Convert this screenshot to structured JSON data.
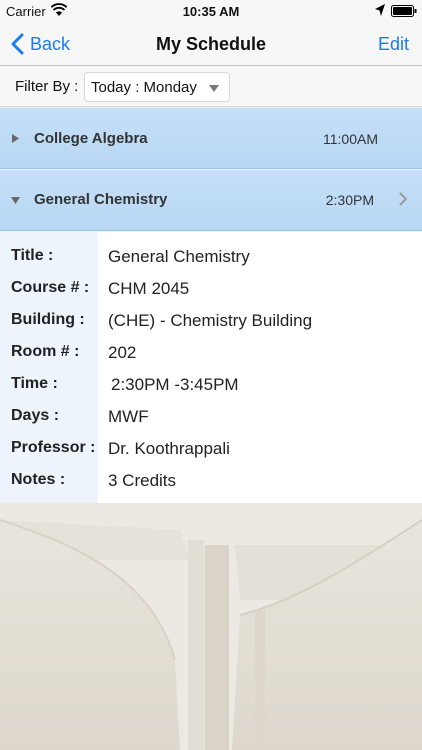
{
  "status_bar": {
    "carrier": "Carrier",
    "time": "10:35 AM",
    "icons": [
      "wifi-icon",
      "location-arrow-icon",
      "battery-icon"
    ]
  },
  "nav": {
    "back_label": "Back",
    "title": "My Schedule",
    "edit_label": "Edit",
    "accent_color": "#1a7cf5"
  },
  "filter": {
    "label": "Filter By :",
    "selected": "Today : Monday"
  },
  "courses": [
    {
      "name": "College Algebra",
      "time": "11:00AM",
      "expanded": false
    },
    {
      "name": "General Chemistry",
      "time": "2:30PM",
      "expanded": true
    }
  ],
  "details": {
    "title_key": "Title :",
    "title_value": "General Chemistry",
    "course_key": "Course # :",
    "course_value": "CHM 2045",
    "building_key": "Building :",
    "building_value": "(CHE) - Chemistry Building",
    "room_key": "Room # :",
    "room_value": "202",
    "time_key": "Time :",
    "time_start": "2:30PM",
    "time_sep": "-",
    "time_end": "3:45PM",
    "days_key": "Days :",
    "days_value": "MWF",
    "professor_key": "Professor :",
    "professor_value": "Dr. Koothrappali",
    "notes_key": "Notes :",
    "notes_value": "3 Credits"
  },
  "colors": {
    "row_highlight": "#b7d7f5",
    "label_column": "#eef4fb"
  }
}
